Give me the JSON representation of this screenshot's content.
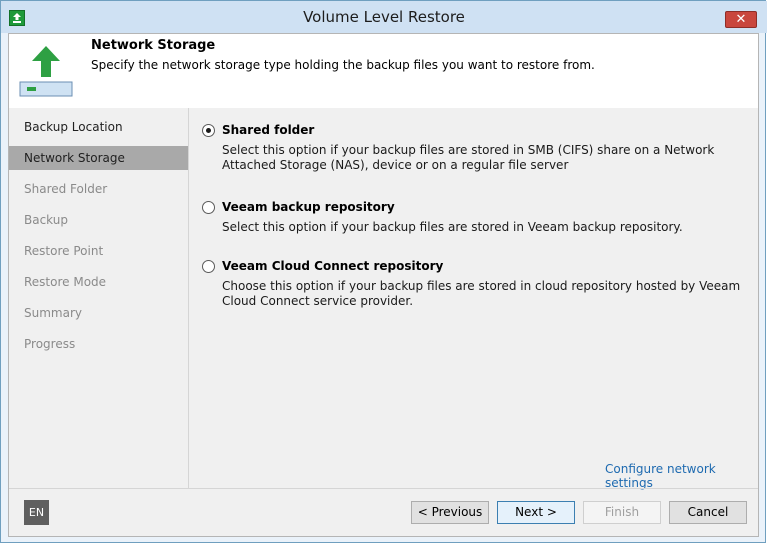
{
  "window": {
    "title": "Volume Level Restore",
    "close_label": "✕"
  },
  "header": {
    "title": "Network Storage",
    "subtitle": "Specify the network storage type holding the backup files you want to restore from."
  },
  "steps": [
    {
      "label": "Backup Location",
      "state": "done"
    },
    {
      "label": "Network Storage",
      "state": "active"
    },
    {
      "label": "Shared Folder",
      "state": "pending"
    },
    {
      "label": "Backup",
      "state": "pending"
    },
    {
      "label": "Restore Point",
      "state": "pending"
    },
    {
      "label": "Restore Mode",
      "state": "pending"
    },
    {
      "label": "Summary",
      "state": "pending"
    },
    {
      "label": "Progress",
      "state": "pending"
    }
  ],
  "options": [
    {
      "title": "Shared folder",
      "desc": "Select this option if your backup files are stored in SMB (CIFS) share on a Network Attached Storage (NAS), device or on a regular file server",
      "checked": true
    },
    {
      "title": "Veeam backup repository",
      "desc": "Select this option if your backup files are stored in Veeam backup repository.",
      "checked": false
    },
    {
      "title": "Veeam Cloud Connect repository",
      "desc": "Choose this option if your backup files are stored in cloud repository hosted by Veeam Cloud Connect service provider.",
      "checked": false
    }
  ],
  "configure_link": "Configure network settings",
  "language": "EN",
  "buttons": {
    "previous": "< Previous",
    "next": "Next >",
    "finish": "Finish",
    "cancel": "Cancel"
  },
  "colors": {
    "accent": "#1f9a3a",
    "link": "#1e6ab0",
    "active_step": "#a9a9a9"
  }
}
